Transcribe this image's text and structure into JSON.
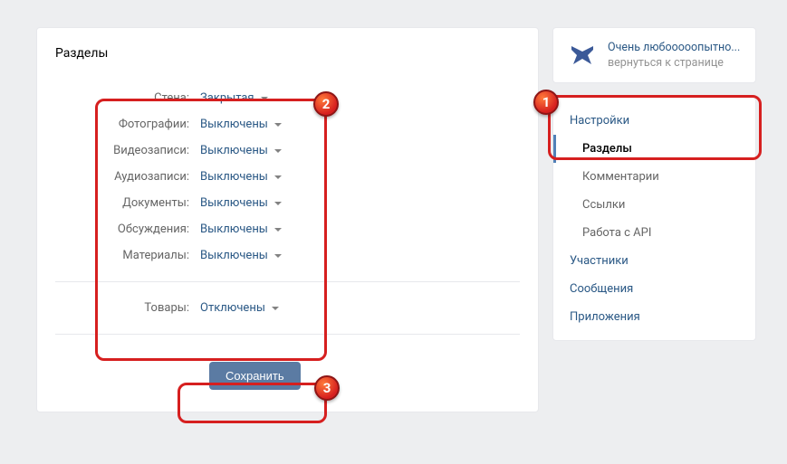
{
  "header": {
    "title": "Разделы"
  },
  "sections": {
    "wall": {
      "label": "Стена:",
      "value": "Закрытая"
    },
    "photos": {
      "label": "Фотографии:",
      "value": "Выключены"
    },
    "videos": {
      "label": "Видеозаписи:",
      "value": "Выключены"
    },
    "audio": {
      "label": "Аудиозаписи:",
      "value": "Выключены"
    },
    "docs": {
      "label": "Документы:",
      "value": "Выключены"
    },
    "discuss": {
      "label": "Обсуждения:",
      "value": "Выключены"
    },
    "materials": {
      "label": "Материалы:",
      "value": "Выключены"
    },
    "goods": {
      "label": "Товары:",
      "value": "Отключены"
    }
  },
  "buttons": {
    "save": "Сохранить"
  },
  "community": {
    "name": "Очень любооооопытно...",
    "back": "вернуться к странице"
  },
  "nav": {
    "settings": "Настройки",
    "sections": "Разделы",
    "comments": "Комментарии",
    "links": "Ссылки",
    "api": "Работа с API",
    "members": "Участники",
    "messages": "Сообщения",
    "apps": "Приложения"
  },
  "annotations": {
    "b1": "1",
    "b2": "2",
    "b3": "3"
  }
}
